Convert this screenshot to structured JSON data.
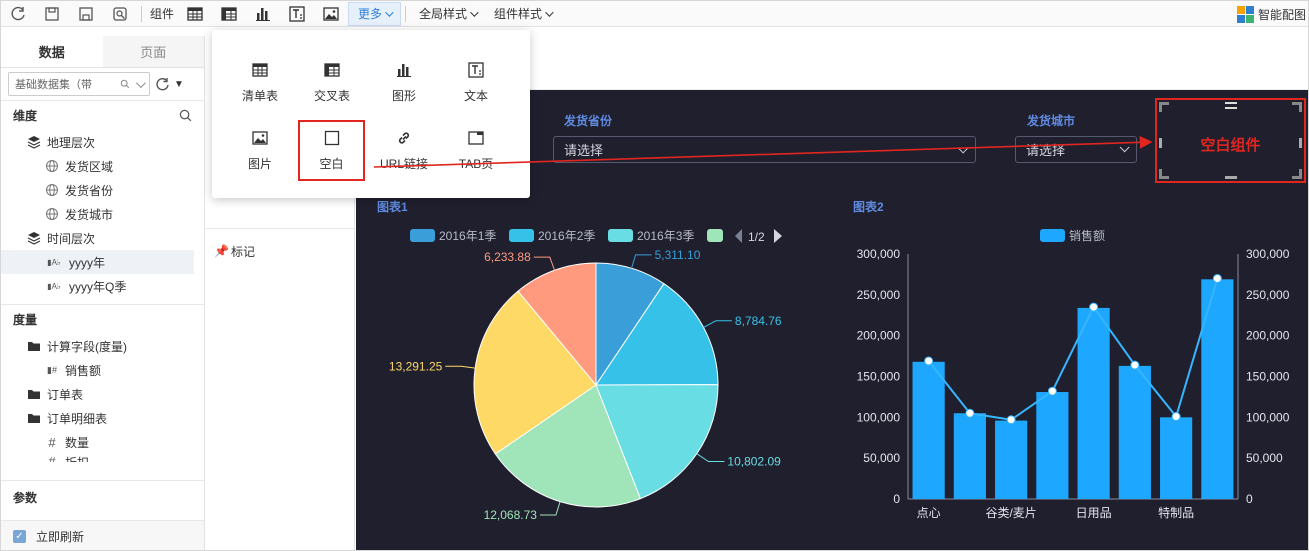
{
  "toolbar": {
    "components_label": "组件",
    "more_label": "更多",
    "global_style_label": "全局样式",
    "component_style_label": "组件样式",
    "smart_layout_label": "智能配图"
  },
  "left_panel": {
    "tabs": [
      "数据",
      "页面"
    ],
    "dataset_select": "基础数据集（带",
    "dimension_title": "维度",
    "geo_group": "地理层次",
    "geo_items": [
      "发货区域",
      "发货省份",
      "发货城市"
    ],
    "time_group": "时间层次",
    "time_items": [
      "yyyy年",
      "yyyy年Q季"
    ],
    "measure_title": "度量",
    "measure_groups": [
      "计算字段(度量)",
      "订单表",
      "订单明细表"
    ],
    "calc_item": "销售额",
    "detail_item": "数量",
    "detail_item_cut": "折扣",
    "params_title": "参数",
    "auto_refresh_label": "立即刷新"
  },
  "middle_panel": {
    "marker_label": "标记"
  },
  "more_menu": {
    "items": [
      "清单表",
      "交叉表",
      "图形",
      "文本",
      "图片",
      "空白",
      "URL链接",
      "TAB页"
    ]
  },
  "filters": {
    "province_label": "发货省份",
    "province_placeholder": "请选择",
    "city_label": "发货城市",
    "city_placeholder": "请选择"
  },
  "blank_component": {
    "label": "空白组件"
  },
  "colors": {
    "canvas_bg": "#1f1f2e",
    "accent_blue": "#2f7fd1",
    "highlight_red": "#e0261f",
    "bar_blue": "#1ea7ff"
  },
  "chart_data": [
    {
      "type": "pie",
      "title": "图表1",
      "legend": [
        "2016年1季",
        "2016年2季",
        "2016年3季"
      ],
      "legend_page": "1/2",
      "labels": [
        "5,311.10",
        "8,784.76",
        "10,802.09",
        "12,068.73",
        "13,291.25",
        "6,233.88"
      ],
      "values": [
        5311.1,
        8784.76,
        10802.09,
        12068.73,
        13291.25,
        6233.88
      ],
      "colors": [
        "#3a9fd8",
        "#36c2e8",
        "#68dde3",
        "#9fe5b9",
        "#ffd966",
        "#ff9a7f"
      ]
    },
    {
      "type": "bar",
      "title": "图表2",
      "legend": [
        "销售额"
      ],
      "x_tick_labels": [
        "点心",
        "谷类/麦片",
        "日用品",
        "特制品"
      ],
      "values": [
        168000,
        105000,
        96000,
        131000,
        234000,
        163000,
        100000,
        269000
      ],
      "line_values": [
        169000,
        105000,
        97000,
        132000,
        235000,
        164000,
        101000,
        270000
      ],
      "y_ticks": [
        "0",
        "50,000",
        "100,000",
        "150,000",
        "200,000",
        "250,000",
        "300,000"
      ],
      "ylim": [
        0,
        300000
      ]
    }
  ]
}
